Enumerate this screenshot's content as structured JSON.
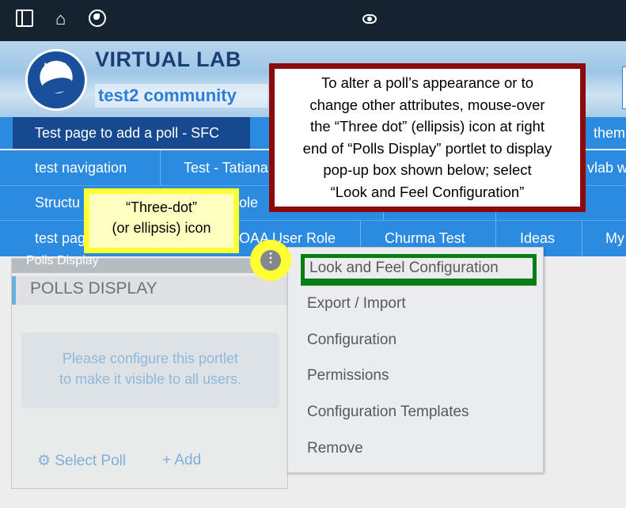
{
  "topbar": {
    "icons": [
      "sidebar-toggle-icon",
      "home-icon",
      "globe-icon",
      "eye-icon"
    ]
  },
  "header": {
    "logo_text": "NOAA",
    "title": "VIRTUAL LAB",
    "subtitle": "test2 community"
  },
  "nav": {
    "row1": [
      "Test page to add a poll - SFC",
      "them"
    ],
    "row2": [
      "test navigation",
      "Test - Tatiana",
      "vlab w"
    ],
    "row3": [
      "Structu",
      "ole"
    ],
    "row4": [
      "test pag",
      "OAA User Role",
      "Churma Test",
      "Ideas",
      "My"
    ]
  },
  "portlet": {
    "top_label": "Polls Display",
    "title": "POLLS DISPLAY",
    "message_line1": "Please configure this portlet",
    "message_line2": "to make it visible to all users.",
    "select_poll": "Select Poll",
    "add": "Add"
  },
  "menu": {
    "items": [
      "Look and Feel Configuration",
      "Export / Import",
      "Configuration",
      "Permissions",
      "Configuration Templates",
      "Remove"
    ]
  },
  "ellipsis_glyph": "⋮",
  "callouts": {
    "instruction": {
      "lines": [
        "To alter a poll’s appearance or to",
        "change other attributes, mouse-over",
        "the “Three dot” (ellipsis) icon at right",
        "end of “Polls Display” portlet to display",
        "pop-up box shown below; select",
        "“Look and Feel Configuration”"
      ]
    },
    "three_dot": {
      "lines": [
        "“Three-dot”",
        "(or ellipsis) icon"
      ]
    }
  },
  "colors": {
    "topbar": "#14232f",
    "nav": "#2a8be0",
    "nav_active": "#16498f",
    "callout_red": "#8b0a0a",
    "callout_yellow": "#ffff33",
    "highlight_green": "#0b7d15"
  }
}
